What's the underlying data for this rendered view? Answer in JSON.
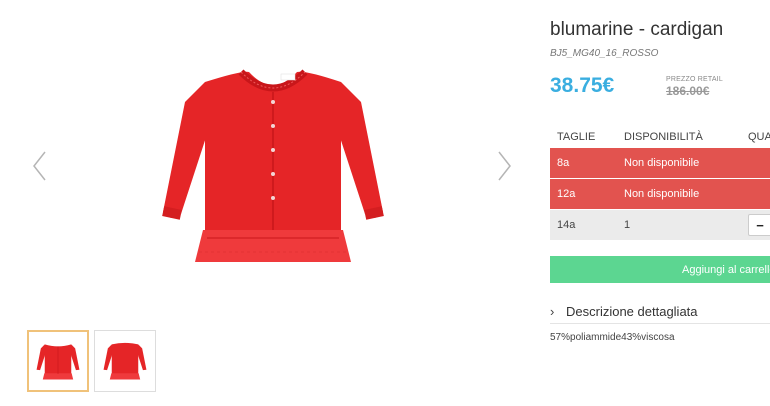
{
  "product": {
    "title": "blumarine - cardigan",
    "sku": "BJ5_MG40_16_ROSSO",
    "price": "38.75€",
    "retail_label": "PREZZO RETAIL",
    "retail_price": "186.00€",
    "description_label": "Descrizione dettagliata",
    "composition": "57%poliammide43%viscosa",
    "color_hex": "#e52527"
  },
  "sizes": {
    "headers": [
      "TAGLIE",
      "DISPONIBILITÀ",
      "QUA"
    ],
    "rows": [
      {
        "size": "8a",
        "availability": "Non disponibile",
        "status": "unavailable"
      },
      {
        "size": "12a",
        "availability": "Non disponibile",
        "status": "unavailable"
      },
      {
        "size": "14a",
        "availability": "1",
        "status": "available",
        "qty_button": "−"
      }
    ]
  },
  "cart": {
    "add_label": "Aggiungi al carrello"
  },
  "gallery": {
    "thumbnail_count": 2,
    "active_index": 0
  },
  "icons": {
    "prev": "chevron-left-icon",
    "next": "chevron-right-icon",
    "expand": "chevron-right-icon"
  },
  "colors": {
    "price": "#3aaee0",
    "unavailable_row": "#e2534f",
    "add_to_cart": "#5cd691",
    "thumb_active_border": "#f0c27a"
  }
}
